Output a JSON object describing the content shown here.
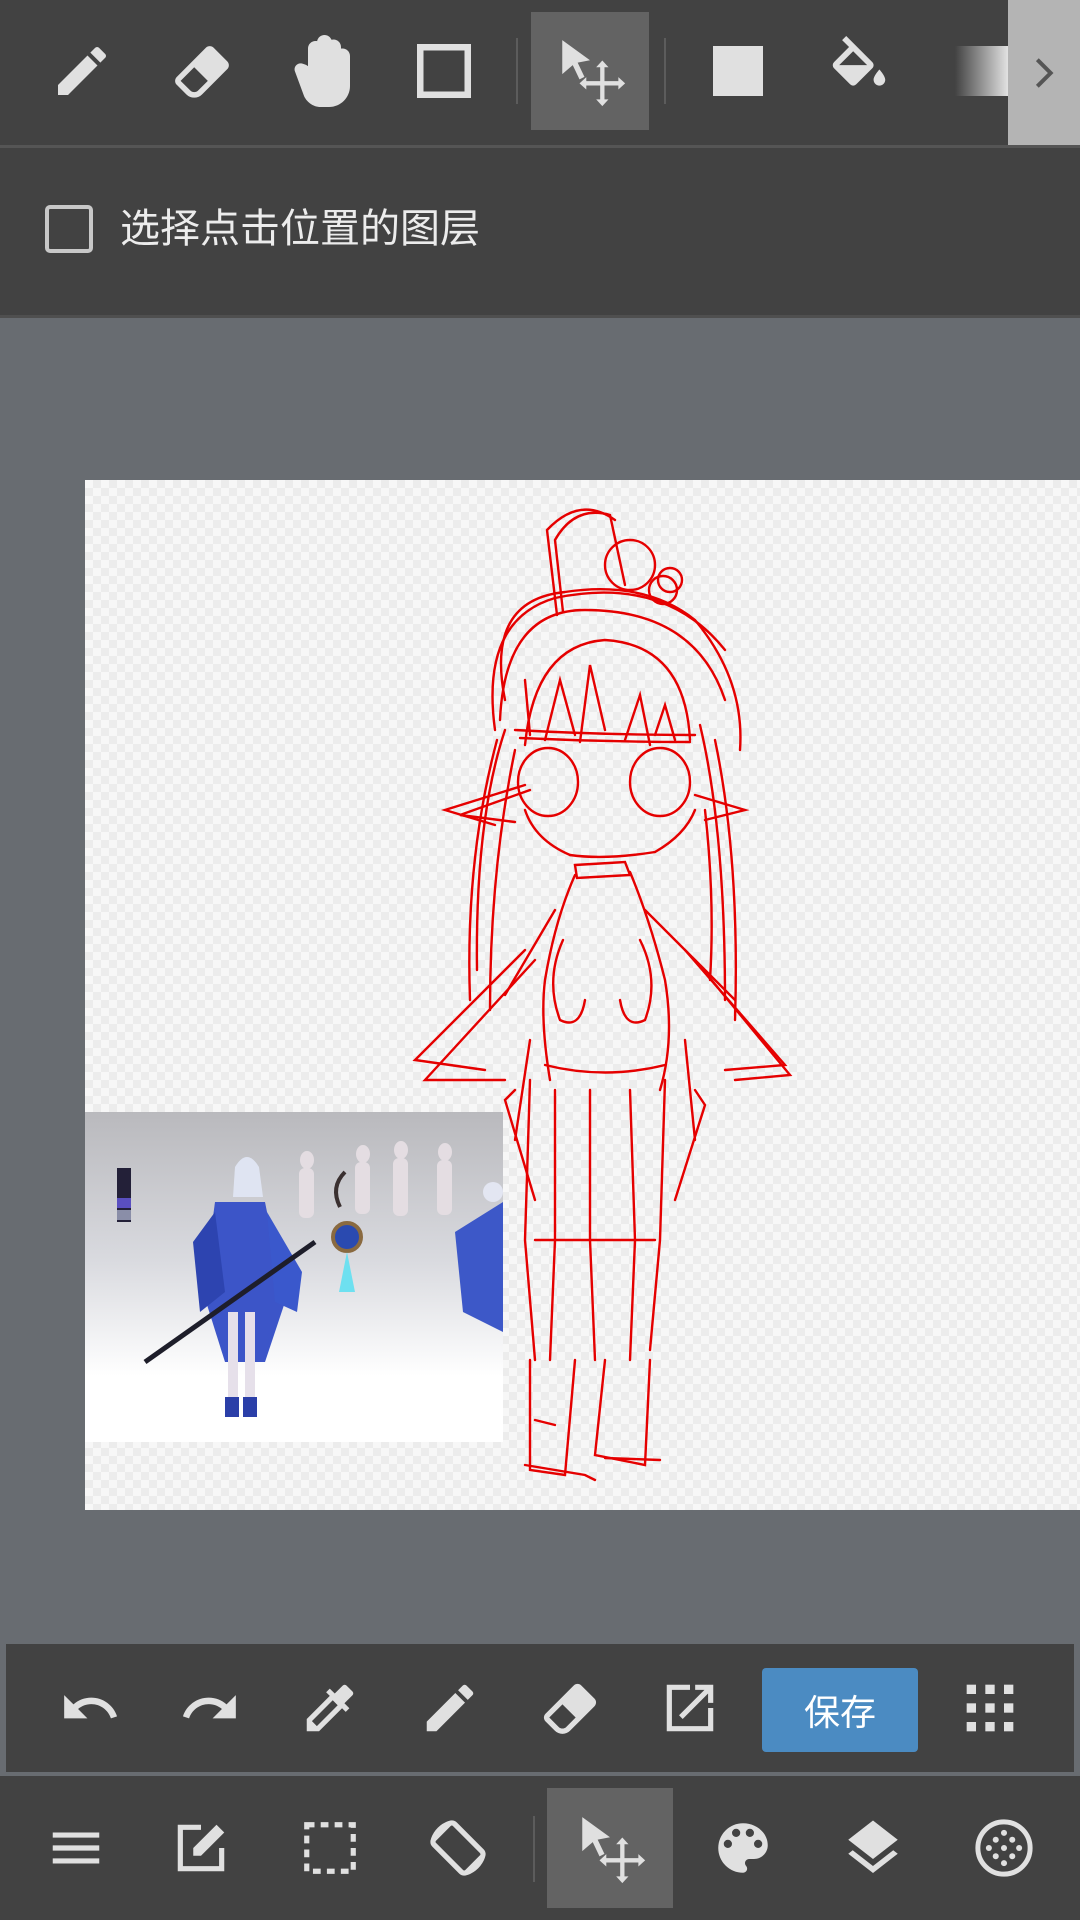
{
  "top_toolbar": {
    "tools": [
      {
        "name": "pen-tool",
        "icon": "pencil-icon"
      },
      {
        "name": "eraser-tool",
        "icon": "eraser-icon"
      },
      {
        "name": "hand-tool",
        "icon": "hand-icon"
      },
      {
        "name": "shape-tool",
        "icon": "square-outline-icon"
      },
      {
        "name": "move-tool",
        "icon": "move-cursor-icon",
        "active": true
      },
      {
        "name": "fill-rect-tool",
        "icon": "filled-square-icon"
      },
      {
        "name": "bucket-tool",
        "icon": "paint-bucket-icon"
      },
      {
        "name": "gradient-tool",
        "icon": "gradient-icon"
      }
    ],
    "more_icon": "chevron-right-icon"
  },
  "options": {
    "select_layer_label": "选择点击位置的图层",
    "select_layer_checked": false
  },
  "bottom_toolbar": {
    "save_label": "保存",
    "actions": [
      "undo-icon",
      "redo-icon",
      "eyedropper-icon",
      "pencil-icon",
      "eraser-icon",
      "export-icon",
      "grid-icon"
    ]
  },
  "nav_bar": {
    "items": [
      "menu-icon",
      "edit-icon",
      "selection-icon",
      "rotate-icon",
      "move-cursor-icon",
      "palette-icon",
      "layers-icon",
      "material-icon"
    ],
    "active": "move-cursor-icon"
  },
  "colors": {
    "toolbar_bg": "#424242",
    "workspace_bg": "#686c71",
    "active_tool_bg": "#636363",
    "save_button": "#4b8bc2",
    "sketch_red": "#e50000"
  }
}
